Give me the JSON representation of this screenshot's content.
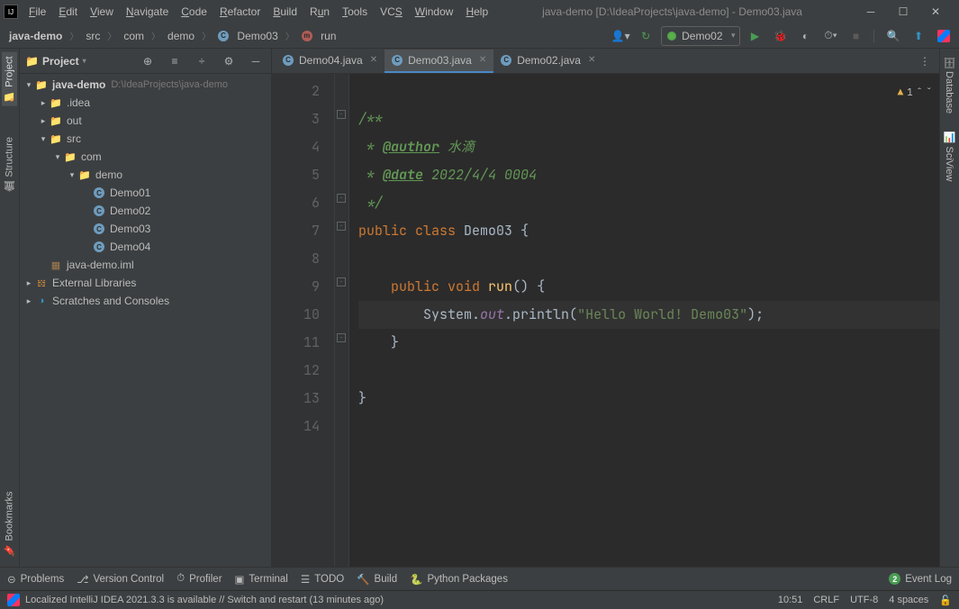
{
  "window": {
    "title": "java-demo [D:\\IdeaProjects\\java-demo] - Demo03.java"
  },
  "menu": [
    "File",
    "Edit",
    "View",
    "Navigate",
    "Code",
    "Refactor",
    "Build",
    "Run",
    "Tools",
    "VCS",
    "Window",
    "Help"
  ],
  "breadcrumb": {
    "root": "java-demo",
    "items": [
      "src",
      "com",
      "demo",
      "Demo03",
      "run"
    ]
  },
  "toolbar": {
    "run_config": "Demo02"
  },
  "project_panel": {
    "title": "Project"
  },
  "tree": {
    "root": {
      "label": "java-demo",
      "path": "D:\\IdeaProjects\\java-demo"
    },
    "idea": ".idea",
    "out": "out",
    "src": "src",
    "com": "com",
    "demo": "demo",
    "classes": [
      "Demo01",
      "Demo02",
      "Demo03",
      "Demo04"
    ],
    "iml": "java-demo.iml",
    "ext": "External Libraries",
    "scratch": "Scratches and Consoles"
  },
  "tabs": [
    "Demo04.java",
    "Demo03.java",
    "Demo02.java"
  ],
  "editor": {
    "lines": {
      "l2": "",
      "l3": "/**",
      "l4_pre": " * ",
      "l4_tag": "@author",
      "l4_after": " 水滴",
      "l5_pre": " * ",
      "l5_tag": "@date",
      "l5_after": " 2022/4/4 0004",
      "l6": " */",
      "l7_kw1": "public ",
      "l7_kw2": "class ",
      "l7_cls": "Demo03",
      "l7_end": " {",
      "l8": "",
      "l9_indent": "    ",
      "l9_kw1": "public ",
      "l9_kw2": "void ",
      "l9_name": "run",
      "l9_end": "() {",
      "l10_indent": "        ",
      "l10_sys": "System.",
      "l10_out": "out",
      "l10_print": ".println(",
      "l10_str": "\"Hello World! Demo03\"",
      "l10_end": ");",
      "l11": "    }",
      "l12": "",
      "l13": "}",
      "l14": ""
    },
    "warning_count": "1"
  },
  "bottom": {
    "problems": "Problems",
    "vcs": "Version Control",
    "profiler": "Profiler",
    "terminal": "Terminal",
    "todo": "TODO",
    "build": "Build",
    "python": "Python Packages",
    "event_n": "2",
    "event": "Event Log"
  },
  "status": {
    "msg": "Localized IntelliJ IDEA 2021.3.3 is available // Switch and restart (13 minutes ago)",
    "pos": "10:51",
    "crlf": "CRLF",
    "enc": "UTF-8",
    "indent": "4 spaces"
  },
  "left_tabs": {
    "project": "Project",
    "structure": "Structure",
    "bookmarks": "Bookmarks"
  },
  "right_tabs": {
    "database": "Database",
    "sciview": "SciView"
  }
}
